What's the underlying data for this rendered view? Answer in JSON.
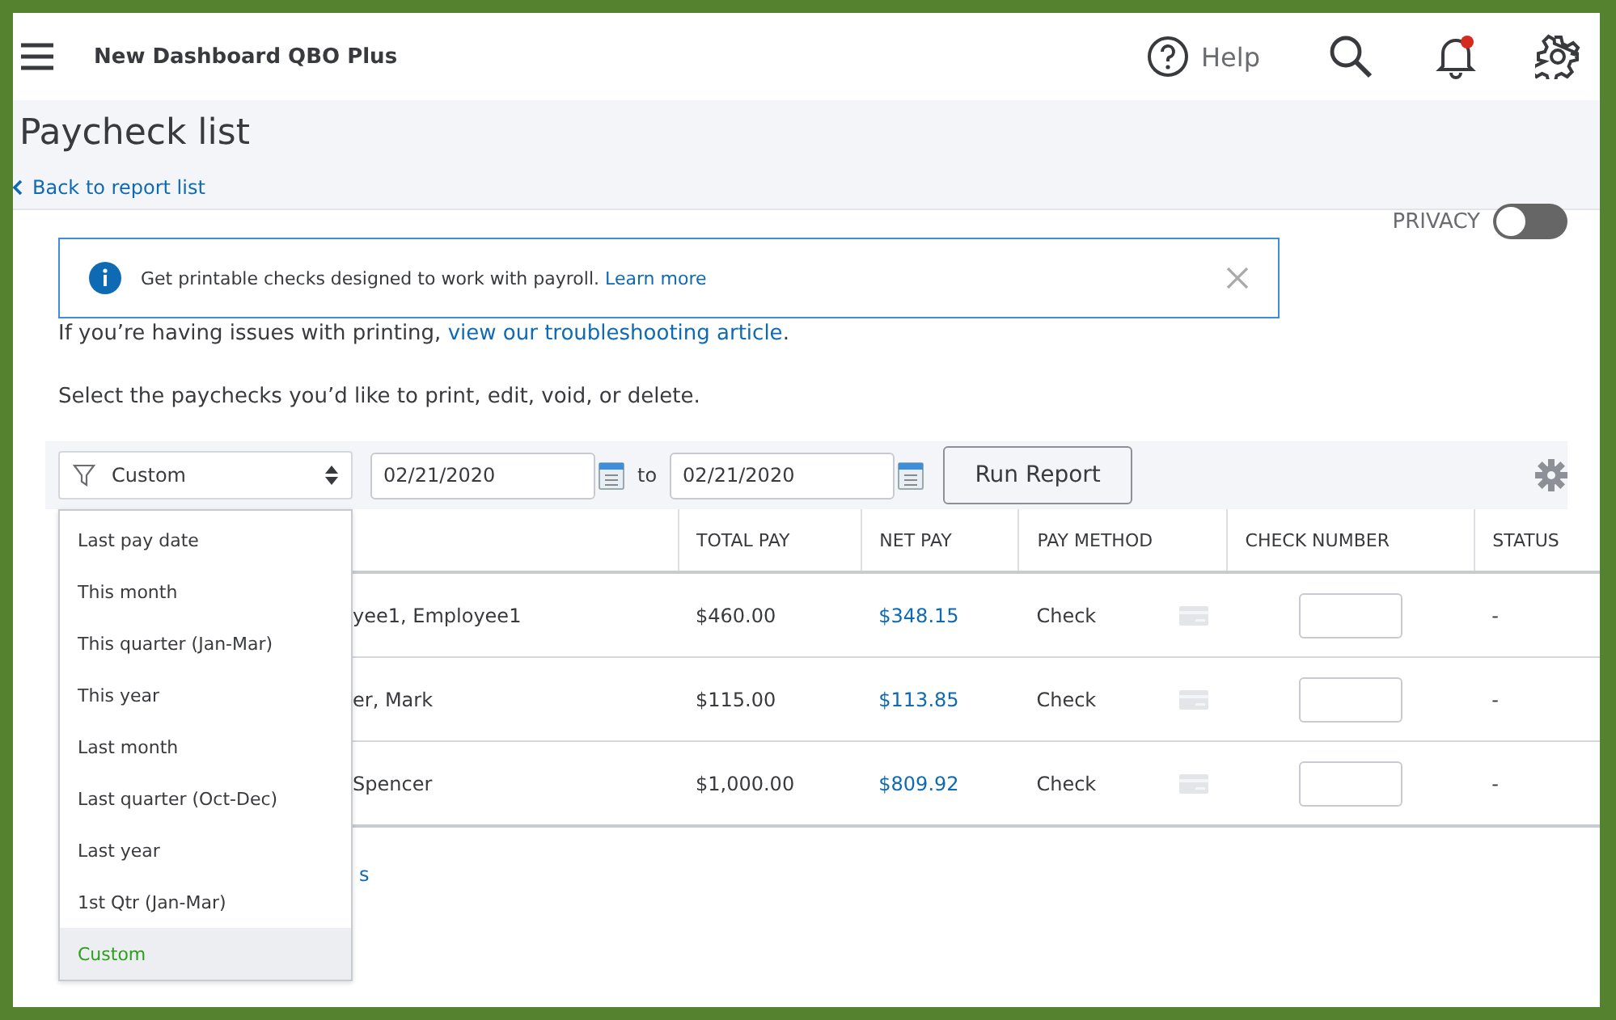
{
  "header": {
    "company": "New Dashboard QBO Plus",
    "help": "Help",
    "notification": true
  },
  "page": {
    "title": "Paycheck list",
    "back_link": "Back to report list"
  },
  "privacy": {
    "label": "PRIVACY",
    "on": false
  },
  "banner": {
    "text": "Get printable checks designed to work with payroll.",
    "link": "Learn more"
  },
  "printing_note": {
    "text": "If you’re having issues with printing,",
    "link": "view our troubleshooting article",
    "end": "."
  },
  "instructions": "Select the paychecks you’d like to print, edit, void, or delete.",
  "filter": {
    "value": "Custom",
    "from": "02/21/2020",
    "to_label": "to",
    "to": "02/21/2020",
    "run_button": "Run Report"
  },
  "dropdown": [
    {
      "label": "Last pay date",
      "selected": false
    },
    {
      "label": "This month",
      "selected": false
    },
    {
      "label": "This quarter (Jan-Mar)",
      "selected": false
    },
    {
      "label": "This year",
      "selected": false
    },
    {
      "label": "Last month",
      "selected": false
    },
    {
      "label": "Last quarter (Oct-Dec)",
      "selected": false
    },
    {
      "label": "Last year",
      "selected": false
    },
    {
      "label": "1st Qtr (Jan-Mar)",
      "selected": false
    },
    {
      "label": "Custom",
      "selected": true
    }
  ],
  "table": {
    "columns": [
      "TOTAL PAY",
      "NET PAY",
      "PAY METHOD",
      "CHECK NUMBER",
      "STATUS"
    ],
    "rows": [
      {
        "name": "yee1, Employee1",
        "total_pay": "$460.00",
        "net_pay": "$348.15",
        "pay_method": "Check",
        "status": "-"
      },
      {
        "name": "er, Mark",
        "total_pay": "$115.00",
        "net_pay": "$113.85",
        "pay_method": "Check",
        "status": "-"
      },
      {
        "name": "Spencer",
        "total_pay": "$1,000.00",
        "net_pay": "$809.92",
        "pay_method": "Check",
        "status": "-"
      }
    ]
  },
  "footer_link": "s"
}
